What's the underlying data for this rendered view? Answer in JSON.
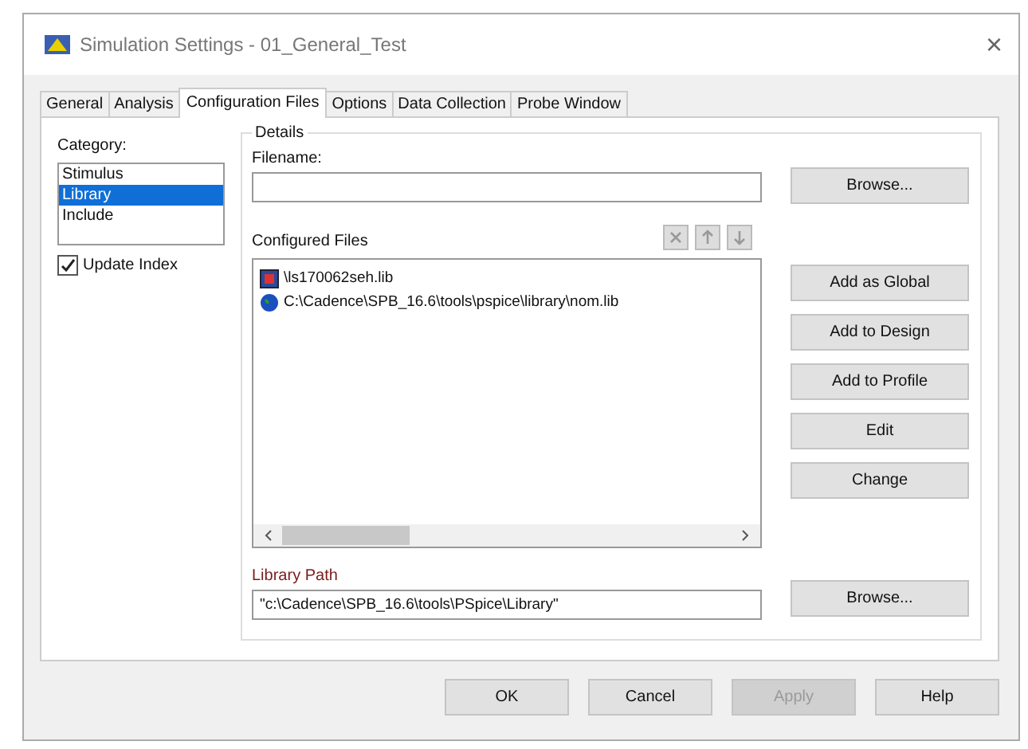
{
  "window": {
    "title": "Simulation Settings - 01_General_Test",
    "close": "×"
  },
  "tabs": [
    {
      "label": "General",
      "selected": false
    },
    {
      "label": "Analysis",
      "selected": false
    },
    {
      "label": "Configuration Files",
      "selected": true
    },
    {
      "label": "Options",
      "selected": false
    },
    {
      "label": "Data Collection",
      "selected": false
    },
    {
      "label": "Probe Window",
      "selected": false
    }
  ],
  "category": {
    "label": "Category:",
    "items": [
      {
        "label": "Stimulus",
        "selected": false
      },
      {
        "label": "Library",
        "selected": true
      },
      {
        "label": "Include",
        "selected": false
      }
    ]
  },
  "update_index": {
    "label": "Update Index",
    "checked": true
  },
  "details": {
    "legend": "Details",
    "filename_label": "Filename:",
    "browse": "Browse..."
  },
  "configured_files": {
    "label": "Configured Files",
    "tools": [
      {
        "kind": "delete",
        "disabled": true
      },
      {
        "kind": "up",
        "disabled": true
      },
      {
        "kind": "down",
        "disabled": true
      }
    ],
    "items": [
      {
        "kind": "design",
        "text": "\\ls170062seh.lib"
      },
      {
        "kind": "global",
        "text": "C:\\Cadence\\SPB_16.6\\tools\\pspice\\library\\nom.lib"
      }
    ]
  },
  "side_buttons": [
    {
      "label": "Add as Global",
      "disabled": false
    },
    {
      "label": "Add to Design",
      "disabled": false
    },
    {
      "label": "Add to Profile",
      "disabled": false
    },
    {
      "label": "Edit",
      "disabled": false
    },
    {
      "label": "Change",
      "disabled": false
    }
  ],
  "library_path": {
    "label": "Library Path",
    "value": "\"c:\\Cadence\\SPB_16.6\\tools\\PSpice\\Library\"",
    "browse": "Browse..."
  },
  "footer": [
    {
      "label": "OK",
      "disabled": false
    },
    {
      "label": "Cancel",
      "disabled": false
    },
    {
      "label": "Apply",
      "disabled": true
    },
    {
      "label": "Help",
      "disabled": false
    }
  ]
}
